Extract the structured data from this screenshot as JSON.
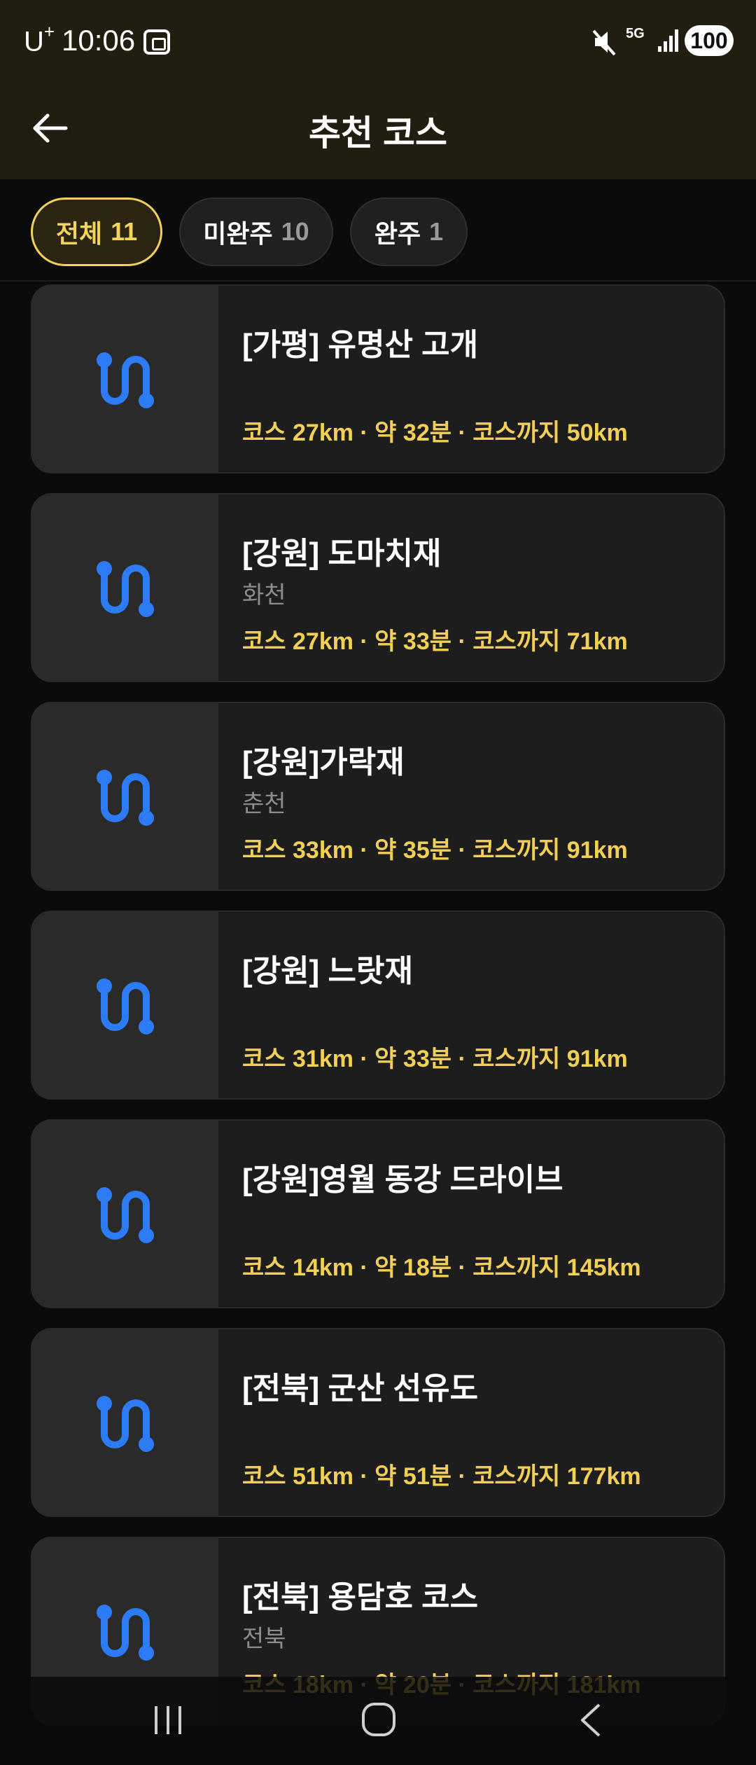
{
  "status": {
    "carrier": "U",
    "carrier_sup": "+",
    "time": "10:06",
    "network": "5G",
    "battery": "100"
  },
  "header": {
    "title": "추천 코스"
  },
  "tabs": [
    {
      "label": "전체",
      "count": "11"
    },
    {
      "label": "미완주",
      "count": "10"
    },
    {
      "label": "완주",
      "count": "1"
    }
  ],
  "courses": [
    {
      "name": "[가평] 유명산 고개",
      "region": "",
      "meta": "코스 27km · 약 32분 · 코스까지 50km"
    },
    {
      "name": "[강원] 도마치재",
      "region": "화천",
      "meta": "코스 27km · 약 33분 · 코스까지 71km"
    },
    {
      "name": "[강원]가락재",
      "region": "춘천",
      "meta": "코스 33km · 약 35분 · 코스까지 91km"
    },
    {
      "name": "[강원] 느랏재",
      "region": "",
      "meta": "코스 31km · 약 33분 · 코스까지 91km"
    },
    {
      "name": "[강원]영월 동강 드라이브",
      "region": "",
      "meta": "코스 14km · 약 18분 · 코스까지 145km"
    },
    {
      "name": "[전북] 군산 선유도",
      "region": "",
      "meta": "코스 51km · 약 51분 · 코스까지 177km"
    },
    {
      "name": "[전북] 용담호 코스",
      "region": "전북",
      "meta": "코스 18km · 약 20분 · 코스까지 181km"
    }
  ],
  "colors": {
    "accent": "#f2cf55",
    "route_icon": "#2d7cf6",
    "background": "#0b0b0b",
    "header_bg": "#211e11"
  }
}
